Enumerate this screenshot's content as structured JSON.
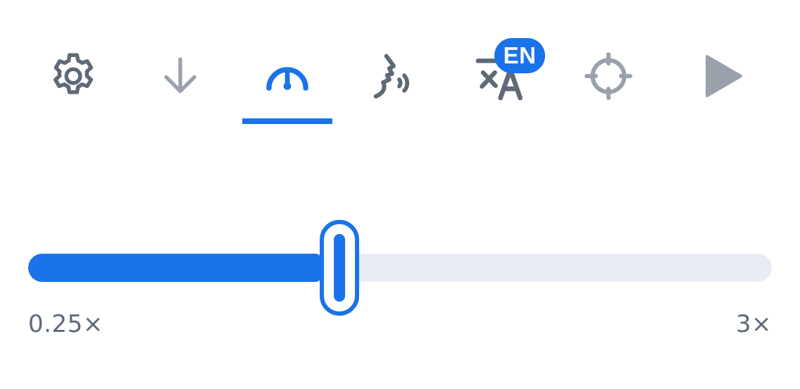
{
  "toolbar": {
    "icons": [
      {
        "name": "gear-icon",
        "color": "#5f6978"
      },
      {
        "name": "download-arrow-icon",
        "color": "#9aa1ab"
      },
      {
        "name": "speedometer-icon",
        "color": "#1a73e8",
        "active": true
      },
      {
        "name": "voice-icon",
        "color": "#5f6978"
      },
      {
        "name": "translate-icon",
        "color": "#5f6978"
      },
      {
        "name": "crosshair-icon",
        "color": "#9aa1ab"
      },
      {
        "name": "play-icon",
        "color": "#9aa1ab"
      }
    ],
    "language_badge": "EN"
  },
  "speed_slider": {
    "min_label": "0.25×",
    "max_label": "3×",
    "min": 0.25,
    "max": 3,
    "value": 1.4
  },
  "colors": {
    "accent": "#1a73e8",
    "icon_dark": "#5f6978",
    "icon_light": "#9aa1ab",
    "track": "#e8ecf4"
  }
}
